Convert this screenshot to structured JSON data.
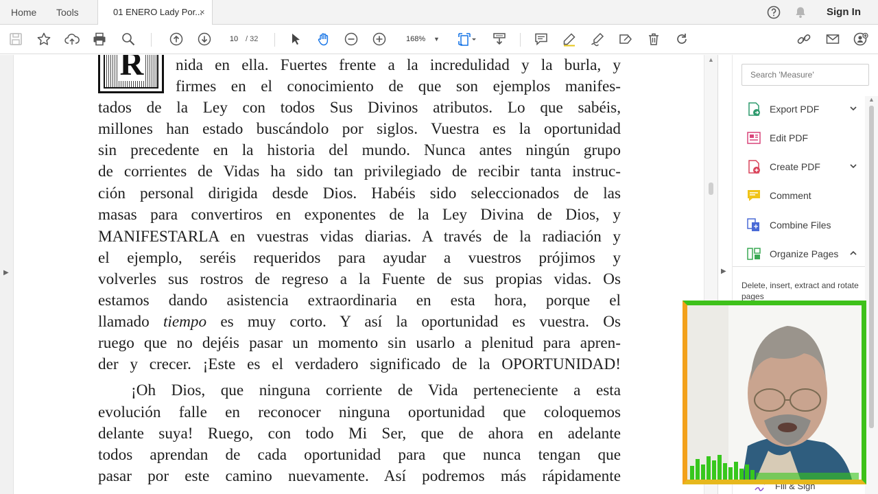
{
  "tabs": {
    "home": "Home",
    "tools": "Tools",
    "document": "01 ENERO Lady Por...",
    "close": "×",
    "sign_in": "Sign In"
  },
  "toolbar": {
    "current_page": "10",
    "page_total": "/  32",
    "zoom": "168%",
    "zoom_caret": "▼"
  },
  "document": {
    "dropcap_letter": "R",
    "lines": [
      "nida en ella. Fuertes frente a la incredulidad y la burla, y",
      "firmes en el conocimiento de que son ejemplos manifes-",
      "tados de la Ley con todos Sus Divinos atributos. Lo que sabéis,",
      "millones han estado buscándolo por siglos. Vuestra es la oportunidad",
      "sin precedente en la historia del mundo. Nunca antes ningún grupo",
      "de corrientes de Vidas ha sido tan privilegiado de recibir tanta instruc-",
      "ción personal dirigida desde Dios. Habéis sido seleccionados de las",
      "masas para convertiros en exponentes de la Ley Divina de Dios, y",
      "MANIFESTARLA en vuestras vidas diarias. A través de la radiación y",
      "el ejemplo, seréis requeridos para ayudar a vuestros prójimos y",
      "volverles sus rostros de regreso a la Fuente de sus propias vidas. Os",
      "estamos dando asistencia extraordinaria en esta hora, porque el",
      "llamado tiempo es muy corto. Y así la oportunidad es vuestra. Os",
      "ruego que no dejéis pasar un momento sin usarlo a plenitud para apren-",
      "der y crecer. ¡Este es el verdadero significado de la OPORTUNIDAD!",
      "¡Oh Dios, que ninguna corriente de Vida perteneciente a esta",
      "evolución falle en reconocer ninguna oportunidad que coloquemos",
      "delante suya! Ruego, con todo Mi Ser, que de ahora en adelante",
      "todos aprendan de cada oportunidad para que nunca tengan que",
      "pasar por este camino nuevamente. Así podremos más rápidamente"
    ]
  },
  "right_panel": {
    "search_placeholder": "Search 'Measure'",
    "tools": [
      {
        "label": "Export PDF",
        "icon": "export-pdf-icon",
        "color": "#2d9a6d"
      },
      {
        "label": "Edit PDF",
        "icon": "edit-pdf-icon",
        "color": "#d9457a"
      },
      {
        "label": "Create PDF",
        "icon": "create-pdf-icon",
        "color": "#d9435a"
      },
      {
        "label": "Comment",
        "icon": "comment-icon",
        "color": "#f0c419"
      },
      {
        "label": "Combine Files",
        "icon": "combine-files-icon",
        "color": "#4a6ad6"
      },
      {
        "label": "Organize Pages",
        "icon": "organize-pages-icon",
        "color": "#3aa853"
      }
    ],
    "organize_description": "Delete, insert, extract and rotate pages",
    "fill_sign": "Fill & Sign"
  },
  "colors": {
    "accent_blue": "#1473e6",
    "webcam_border_green": "#3ec11a",
    "webcam_border_orange": "#f3a11b"
  }
}
